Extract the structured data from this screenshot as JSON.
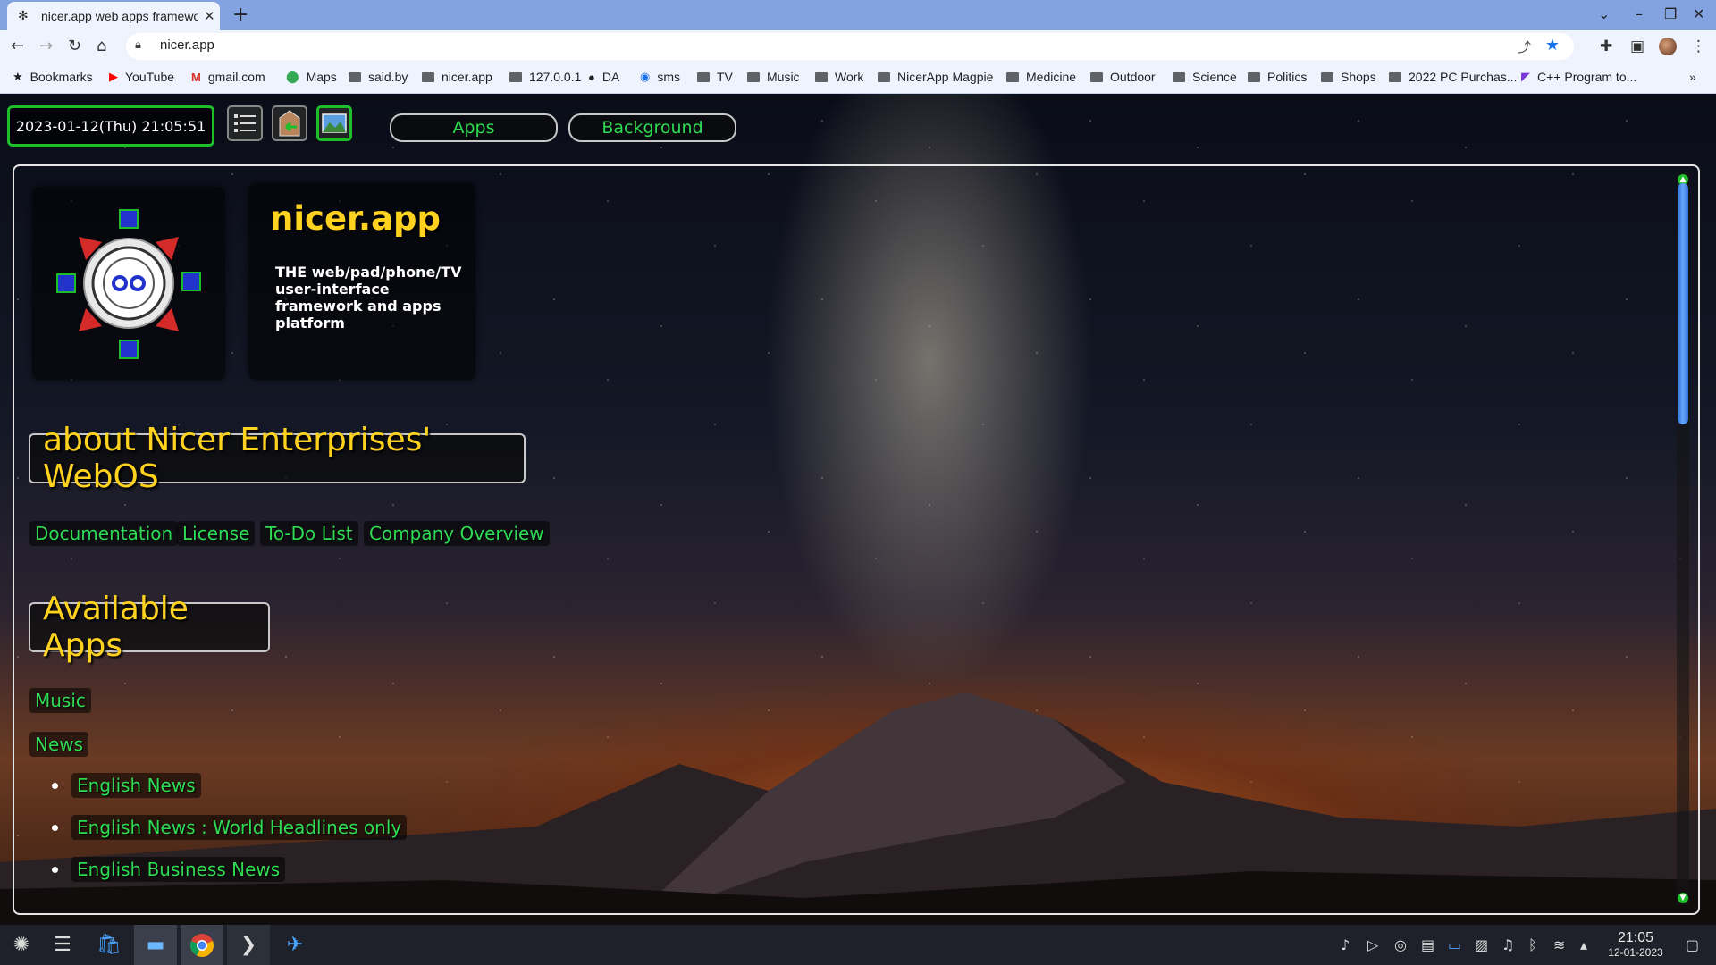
{
  "browser": {
    "tab_title": "nicer.app web apps framewo",
    "url": "nicer.app"
  },
  "bookmarks": [
    {
      "label": "Bookmarks",
      "icon": "star-icon"
    },
    {
      "label": "YouTube",
      "icon": "youtube-icon"
    },
    {
      "label": "gmail.com",
      "icon": "gmail-icon"
    },
    {
      "label": "Maps",
      "icon": "maps-icon"
    },
    {
      "label": "said.by",
      "icon": "folder-icon"
    },
    {
      "label": "nicer.app",
      "icon": "folder-icon"
    },
    {
      "label": "127.0.0.1",
      "icon": "folder-icon"
    },
    {
      "label": "DA",
      "icon": "github-icon"
    },
    {
      "label": "sms",
      "icon": "messages-icon"
    },
    {
      "label": "TV",
      "icon": "folder-icon"
    },
    {
      "label": "Music",
      "icon": "folder-icon"
    },
    {
      "label": "Work",
      "icon": "folder-icon"
    },
    {
      "label": "NicerApp Magpie",
      "icon": "folder-icon"
    },
    {
      "label": "Medicine",
      "icon": "folder-icon"
    },
    {
      "label": "Outdoor",
      "icon": "folder-icon"
    },
    {
      "label": "Science",
      "icon": "folder-icon"
    },
    {
      "label": "Politics",
      "icon": "folder-icon"
    },
    {
      "label": "Shops",
      "icon": "folder-icon"
    },
    {
      "label": "2022 PC Purchas...",
      "icon": "folder-icon"
    },
    {
      "label": "C++ Program to...",
      "icon": "page-icon"
    }
  ],
  "site": {
    "datetime": "2023-01-12(Thu) 21:05:51",
    "nav_apps": "Apps",
    "nav_background": "Background",
    "brand_title": "nicer.app",
    "brand_subtitle": "THE web/pad/phone/TV user-interface framework and apps platform",
    "about_heading": "about Nicer Enterprises' WebOS",
    "about_links": [
      "Documentation",
      "License",
      "To-Do List",
      "Company Overview"
    ],
    "apps_heading": "Available Apps",
    "apps": [
      "Music",
      "News"
    ],
    "news_items": [
      "English News",
      "English News : World Headlines only",
      "English Business News"
    ]
  },
  "taskbar": {
    "time": "21:05",
    "date": "12-01-2023"
  },
  "colors": {
    "accent_green": "#2fdb53",
    "heading_yellow": "#ffd21f",
    "border_green": "#1ebd2a"
  }
}
